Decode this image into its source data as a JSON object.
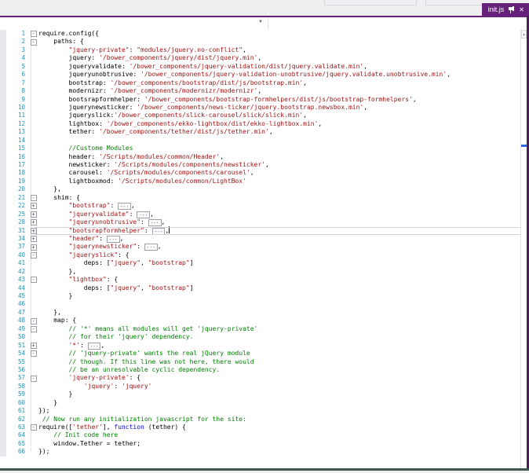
{
  "tab": {
    "label": "init.js",
    "close_glyph": "✕",
    "bg": "#68217A"
  },
  "navbar": {
    "left_value": "",
    "right_value": "",
    "dropdown_icon": "▼"
  },
  "chrome": {
    "accent": "#68217A",
    "strip_bg": "#EFEFF2",
    "right_border": "#4A2155",
    "bottom_border": "#3E5650",
    "scroll_marker": "#3365D6"
  },
  "scrollbar": {
    "arrow_glyph": "▲"
  },
  "editor": {
    "colors": {
      "line_number": "#2B91AF",
      "default": "#000000",
      "string": "#A31515",
      "comment": "#008000",
      "keyword": "#0000FF",
      "current_line_border": "#D2D2DC"
    },
    "lines": [
      {
        "n": 1,
        "fold": "-",
        "seg": [
          [
            "d",
            "require.config({"
          ]
        ]
      },
      {
        "n": 2,
        "fold": "-",
        "seg": [
          [
            "d",
            "    paths: {"
          ]
        ]
      },
      {
        "n": 3,
        "seg": [
          [
            "d",
            "        "
          ],
          [
            "s",
            "\"jquery-private\""
          ],
          [
            "d",
            ": "
          ],
          [
            "s",
            "\"modules/jquery.no-conflict\""
          ],
          [
            "d",
            ","
          ]
        ]
      },
      {
        "n": 4,
        "seg": [
          [
            "d",
            "        jquery: "
          ],
          [
            "s",
            "'/bower_components/jquery/dist/jquery.min'"
          ],
          [
            "d",
            ","
          ]
        ]
      },
      {
        "n": 5,
        "seg": [
          [
            "d",
            "        jqueryvalidate: "
          ],
          [
            "s",
            "'/bower_components/jquery-validation/dist/jquery.validate.min'"
          ],
          [
            "d",
            ","
          ]
        ]
      },
      {
        "n": 6,
        "seg": [
          [
            "d",
            "        jqueryunobtrusive: "
          ],
          [
            "s",
            "'/bower_components/jquery-validation-unobtrusive/jquery.validate.unobtrusive.min'"
          ],
          [
            "d",
            ","
          ]
        ]
      },
      {
        "n": 7,
        "seg": [
          [
            "d",
            "        bootstrap: "
          ],
          [
            "s",
            "'/bower_components/bootstrap/dist/js/bootstrap.min'"
          ],
          [
            "d",
            ","
          ]
        ]
      },
      {
        "n": 8,
        "seg": [
          [
            "d",
            "        modernizr: "
          ],
          [
            "s",
            "'/bower_components/modernizr/modernizr'"
          ],
          [
            "d",
            ","
          ]
        ]
      },
      {
        "n": 9,
        "seg": [
          [
            "d",
            "        bootsrapformhelper: "
          ],
          [
            "s",
            "'/bower_components/bootstrap-formhelpers/dist/js/bootstrap-formhelpers'"
          ],
          [
            "d",
            ","
          ]
        ]
      },
      {
        "n": 10,
        "seg": [
          [
            "d",
            "        jquerynewsticker: "
          ],
          [
            "s",
            "'/bower_components/news-ticker/jquery.bootstrap.newsbox.min'"
          ],
          [
            "d",
            ","
          ]
        ]
      },
      {
        "n": 11,
        "seg": [
          [
            "d",
            "        jqueryslick:"
          ],
          [
            "s",
            "'/bower_components/slick-carousel/slick/slick.min'"
          ],
          [
            "d",
            ","
          ]
        ]
      },
      {
        "n": 12,
        "seg": [
          [
            "d",
            "        lightbox: "
          ],
          [
            "s",
            "'/bower_components/ekko-lightbox/dist/ekko-lightbox.min'"
          ],
          [
            "d",
            ","
          ]
        ]
      },
      {
        "n": 13,
        "seg": [
          [
            "d",
            "        tether: "
          ],
          [
            "s",
            "'/bower_components/tether/dist/js/tether.min'"
          ],
          [
            "d",
            ","
          ]
        ]
      },
      {
        "n": 14,
        "seg": []
      },
      {
        "n": 15,
        "seg": [
          [
            "c",
            "        //Custome Modules"
          ]
        ]
      },
      {
        "n": 16,
        "seg": [
          [
            "d",
            "        header: "
          ],
          [
            "s",
            "'/Scripts/modules/common/Header'"
          ],
          [
            "d",
            ","
          ]
        ]
      },
      {
        "n": 17,
        "seg": [
          [
            "d",
            "        newsticker: "
          ],
          [
            "s",
            "'/Scripts/modules/components/newsticker'"
          ],
          [
            "d",
            ","
          ]
        ]
      },
      {
        "n": 18,
        "seg": [
          [
            "d",
            "        carousel: "
          ],
          [
            "s",
            "'/Scripts/modules/components/carousel'"
          ],
          [
            "d",
            ","
          ]
        ]
      },
      {
        "n": 19,
        "seg": [
          [
            "d",
            "        lightboxmod: "
          ],
          [
            "s",
            "'/Scripts/modules/common/LightBox'"
          ]
        ]
      },
      {
        "n": 20,
        "seg": [
          [
            "d",
            "    },"
          ]
        ]
      },
      {
        "n": 21,
        "fold": "-",
        "seg": [
          [
            "d",
            "    shim: {"
          ]
        ]
      },
      {
        "n": 22,
        "fold": "+",
        "seg": [
          [
            "d",
            "        "
          ],
          [
            "s",
            "\"bootstrap\""
          ],
          [
            "d",
            ": "
          ],
          [
            "box",
            "..."
          ],
          [
            "d",
            ","
          ]
        ]
      },
      {
        "n": 25,
        "fold": "+",
        "seg": [
          [
            "d",
            "        "
          ],
          [
            "s",
            "\"jqueryvalidate\""
          ],
          [
            "d",
            ": "
          ],
          [
            "box",
            "..."
          ],
          [
            "d",
            ","
          ]
        ]
      },
      {
        "n": 28,
        "fold": "+",
        "seg": [
          [
            "d",
            "        "
          ],
          [
            "s",
            "\"jqueryunobtrusive\""
          ],
          [
            "d",
            ": "
          ],
          [
            "box",
            "..."
          ],
          [
            "d",
            ","
          ]
        ]
      },
      {
        "n": 31,
        "fold": "+",
        "cur": true,
        "seg": [
          [
            "d",
            "        "
          ],
          [
            "s",
            "\"bootsrapformhelper\""
          ],
          [
            "d",
            ": "
          ],
          [
            "box",
            "..."
          ],
          [
            "d",
            ","
          ],
          [
            "caret",
            ""
          ]
        ]
      },
      {
        "n": 34,
        "fold": "+",
        "seg": [
          [
            "d",
            "        "
          ],
          [
            "s",
            "\"header\""
          ],
          [
            "d",
            ": "
          ],
          [
            "box",
            "..."
          ],
          [
            "d",
            ","
          ]
        ]
      },
      {
        "n": 37,
        "fold": "+",
        "seg": [
          [
            "d",
            "        "
          ],
          [
            "s",
            "\"jquerynewsticker\""
          ],
          [
            "d",
            ": "
          ],
          [
            "box",
            "..."
          ],
          [
            "d",
            ","
          ]
        ]
      },
      {
        "n": 40,
        "fold": "-",
        "seg": [
          [
            "d",
            "        "
          ],
          [
            "s",
            "\"jqueryslick\""
          ],
          [
            "d",
            ": {"
          ]
        ]
      },
      {
        "n": 41,
        "seg": [
          [
            "d",
            "            deps: ["
          ],
          [
            "s",
            "\"jquery\""
          ],
          [
            "d",
            ", "
          ],
          [
            "s",
            "\"bootstrap\""
          ],
          [
            "d",
            "]"
          ]
        ]
      },
      {
        "n": 42,
        "seg": [
          [
            "d",
            "        },"
          ]
        ]
      },
      {
        "n": 43,
        "fold": "-",
        "seg": [
          [
            "d",
            "        "
          ],
          [
            "s",
            "\"lightbox\""
          ],
          [
            "d",
            ": {"
          ]
        ]
      },
      {
        "n": 44,
        "seg": [
          [
            "d",
            "            deps: ["
          ],
          [
            "s",
            "\"jquery\""
          ],
          [
            "d",
            ", "
          ],
          [
            "s",
            "\"bootstrap\""
          ],
          [
            "d",
            "]"
          ]
        ]
      },
      {
        "n": 45,
        "seg": [
          [
            "d",
            "        }"
          ]
        ]
      },
      {
        "n": 46,
        "seg": []
      },
      {
        "n": 47,
        "seg": [
          [
            "d",
            "    },"
          ]
        ]
      },
      {
        "n": 48,
        "fold": "-",
        "seg": [
          [
            "d",
            "    map: {"
          ]
        ]
      },
      {
        "n": 49,
        "fold": "-",
        "seg": [
          [
            "c",
            "        // '*' means all modules will get 'jquery-private'"
          ]
        ]
      },
      {
        "n": 50,
        "seg": [
          [
            "c",
            "        // for their 'jquery' dependency."
          ]
        ]
      },
      {
        "n": 51,
        "fold": "+",
        "seg": [
          [
            "d",
            "        "
          ],
          [
            "s",
            "'*'"
          ],
          [
            "d",
            ": "
          ],
          [
            "box",
            "..."
          ],
          [
            "d",
            ","
          ]
        ]
      },
      {
        "n": 54,
        "fold": "-",
        "seg": [
          [
            "c",
            "        // 'jquery-private' wants the real jQuery module"
          ]
        ]
      },
      {
        "n": 55,
        "seg": [
          [
            "c",
            "        // though. If this line was not here, there would"
          ]
        ]
      },
      {
        "n": 56,
        "seg": [
          [
            "c",
            "        // be an unresolvable cyclic dependency."
          ]
        ]
      },
      {
        "n": 57,
        "fold": "-",
        "seg": [
          [
            "d",
            "        "
          ],
          [
            "s",
            "'jquery-private'"
          ],
          [
            "d",
            ": {"
          ]
        ]
      },
      {
        "n": 58,
        "seg": [
          [
            "d",
            "            "
          ],
          [
            "s",
            "'jquery'"
          ],
          [
            "d",
            ": "
          ],
          [
            "s",
            "'jquery'"
          ]
        ]
      },
      {
        "n": 59,
        "seg": [
          [
            "d",
            "        }"
          ]
        ]
      },
      {
        "n": 60,
        "seg": [
          [
            "d",
            "    }"
          ]
        ]
      },
      {
        "n": 61,
        "seg": [
          [
            "d",
            "});"
          ]
        ]
      },
      {
        "n": 62,
        "seg": [
          [
            "c",
            " // Now run any initialization javascript for the site:"
          ]
        ]
      },
      {
        "n": 63,
        "fold": "-",
        "seg": [
          [
            "d",
            "require(["
          ],
          [
            "s",
            "'tether'"
          ],
          [
            "d",
            "], "
          ],
          [
            "k",
            "function"
          ],
          [
            "d",
            " (tether) {"
          ]
        ]
      },
      {
        "n": 64,
        "seg": [
          [
            "c",
            "    // Init code here"
          ]
        ]
      },
      {
        "n": 65,
        "seg": [
          [
            "d",
            "    window.Tether = tether;"
          ]
        ]
      },
      {
        "n": 66,
        "seg": [
          [
            "d",
            "});"
          ]
        ]
      }
    ]
  }
}
